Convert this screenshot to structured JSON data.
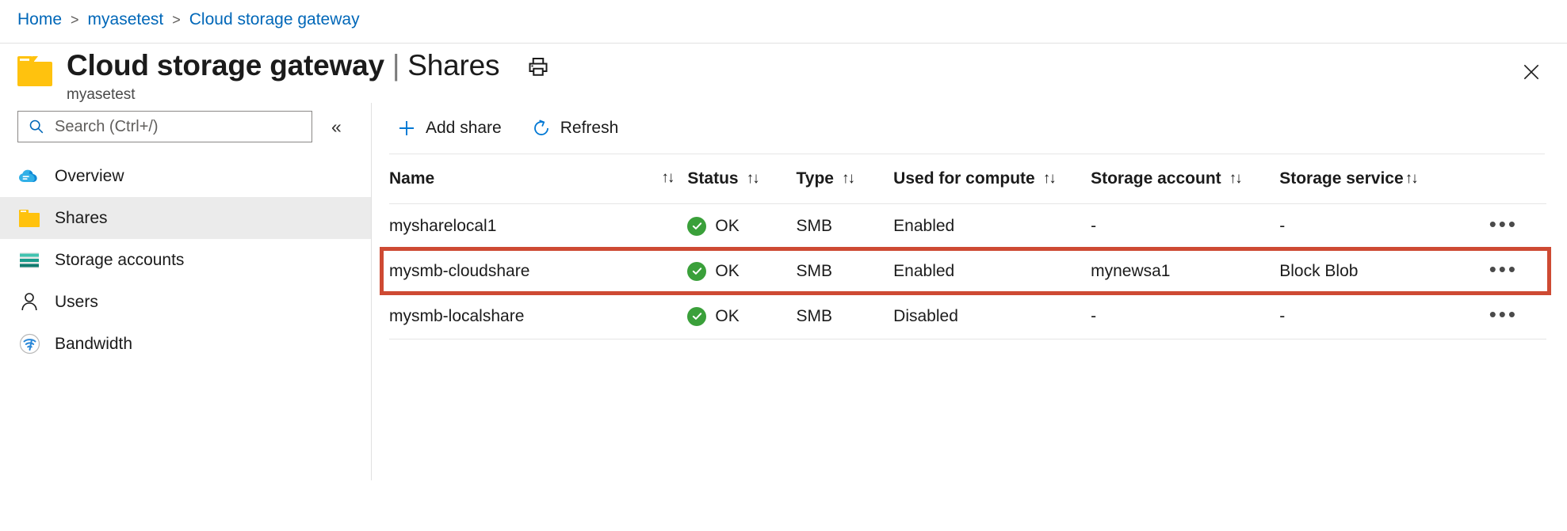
{
  "breadcrumb": {
    "items": [
      {
        "label": "Home"
      },
      {
        "label": "myasetest"
      },
      {
        "label": "Cloud storage gateway"
      }
    ],
    "separator": ">"
  },
  "header": {
    "icon": "folder-icon",
    "title": "Cloud storage gateway",
    "title_separator": "|",
    "title_section": "Shares",
    "subtitle": "myasetest",
    "print_icon": "print-icon",
    "close_icon": "close-icon"
  },
  "sidebar": {
    "search": {
      "placeholder": "Search (Ctrl+/)",
      "value": "",
      "icon": "search-icon"
    },
    "collapse_label": "«",
    "items": [
      {
        "label": "Overview",
        "icon": "cloud-icon",
        "selected": false
      },
      {
        "label": "Shares",
        "icon": "folder-icon",
        "selected": true
      },
      {
        "label": "Storage accounts",
        "icon": "storage-account-icon",
        "selected": false
      },
      {
        "label": "Users",
        "icon": "person-icon",
        "selected": false
      },
      {
        "label": "Bandwidth",
        "icon": "bandwidth-icon",
        "selected": false
      }
    ]
  },
  "toolbar": {
    "add_share_label": "Add share",
    "add_share_icon": "plus-icon",
    "refresh_label": "Refresh",
    "refresh_icon": "refresh-icon"
  },
  "table": {
    "columns": [
      {
        "label": "Name",
        "sortable": true
      },
      {
        "label": "Status",
        "sortable": true
      },
      {
        "label": "Type",
        "sortable": true
      },
      {
        "label": "Used for compute",
        "sortable": true
      },
      {
        "label": "Storage account",
        "sortable": true
      },
      {
        "label": "Storage service",
        "sortable": true
      }
    ],
    "sort_icon": "↑↓",
    "actions_icon": "•••",
    "rows": [
      {
        "name": "mysharelocal1",
        "status": "OK",
        "status_icon": "check-circle-icon",
        "type": "SMB",
        "used_for_compute": "Enabled",
        "storage_account": "-",
        "storage_service": "-",
        "highlighted": false
      },
      {
        "name": "mysmb-cloudshare",
        "status": "OK",
        "status_icon": "check-circle-icon",
        "type": "SMB",
        "used_for_compute": "Enabled",
        "storage_account": "mynewsa1",
        "storage_service": "Block Blob",
        "highlighted": true
      },
      {
        "name": "mysmb-localshare",
        "status": "OK",
        "status_icon": "check-circle-icon",
        "type": "SMB",
        "used_for_compute": "Disabled",
        "storage_account": "-",
        "storage_service": "-",
        "highlighted": false
      }
    ]
  },
  "colors": {
    "link": "#0067b8",
    "accent_folder": "#ffc20e",
    "status_ok": "#3aa03a",
    "highlight_border": "#ce4a33",
    "selected_row_bg": "#ebebeb"
  }
}
